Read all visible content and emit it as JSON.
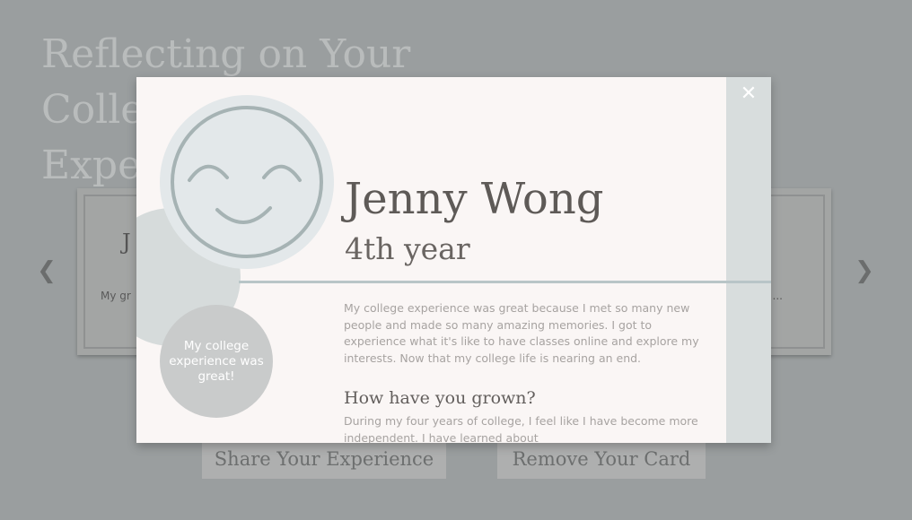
{
  "page": {
    "title": "Reflecting on Your College Experience"
  },
  "cards": {
    "left": {
      "name": "J",
      "snippet": "My gr"
    },
    "right": {
      "snippet": "..."
    }
  },
  "nav": {
    "prev_icon": "chevron-left-icon",
    "next_icon": "chevron-right-icon"
  },
  "buttons": {
    "share": "Share Your Experience",
    "remove": "Remove Your Card"
  },
  "modal": {
    "close_icon": "close-icon",
    "name": "Jenny Wong",
    "year": "4th year",
    "quote": "My college experience was great!",
    "paragraph": "My college experience was great because I met so many new people and made so many amazing memories. I got to experience what it's like to have classes online and explore my interests. Now that my college life is nearing an end.",
    "question": "How have you grown?",
    "answer": "During my four years of college, I feel like I have become more independent. I have learned about"
  },
  "colors": {
    "overlay": "#9a9e9f",
    "modal_bg": "#faf6f5",
    "accent": "#b8c5c7"
  }
}
